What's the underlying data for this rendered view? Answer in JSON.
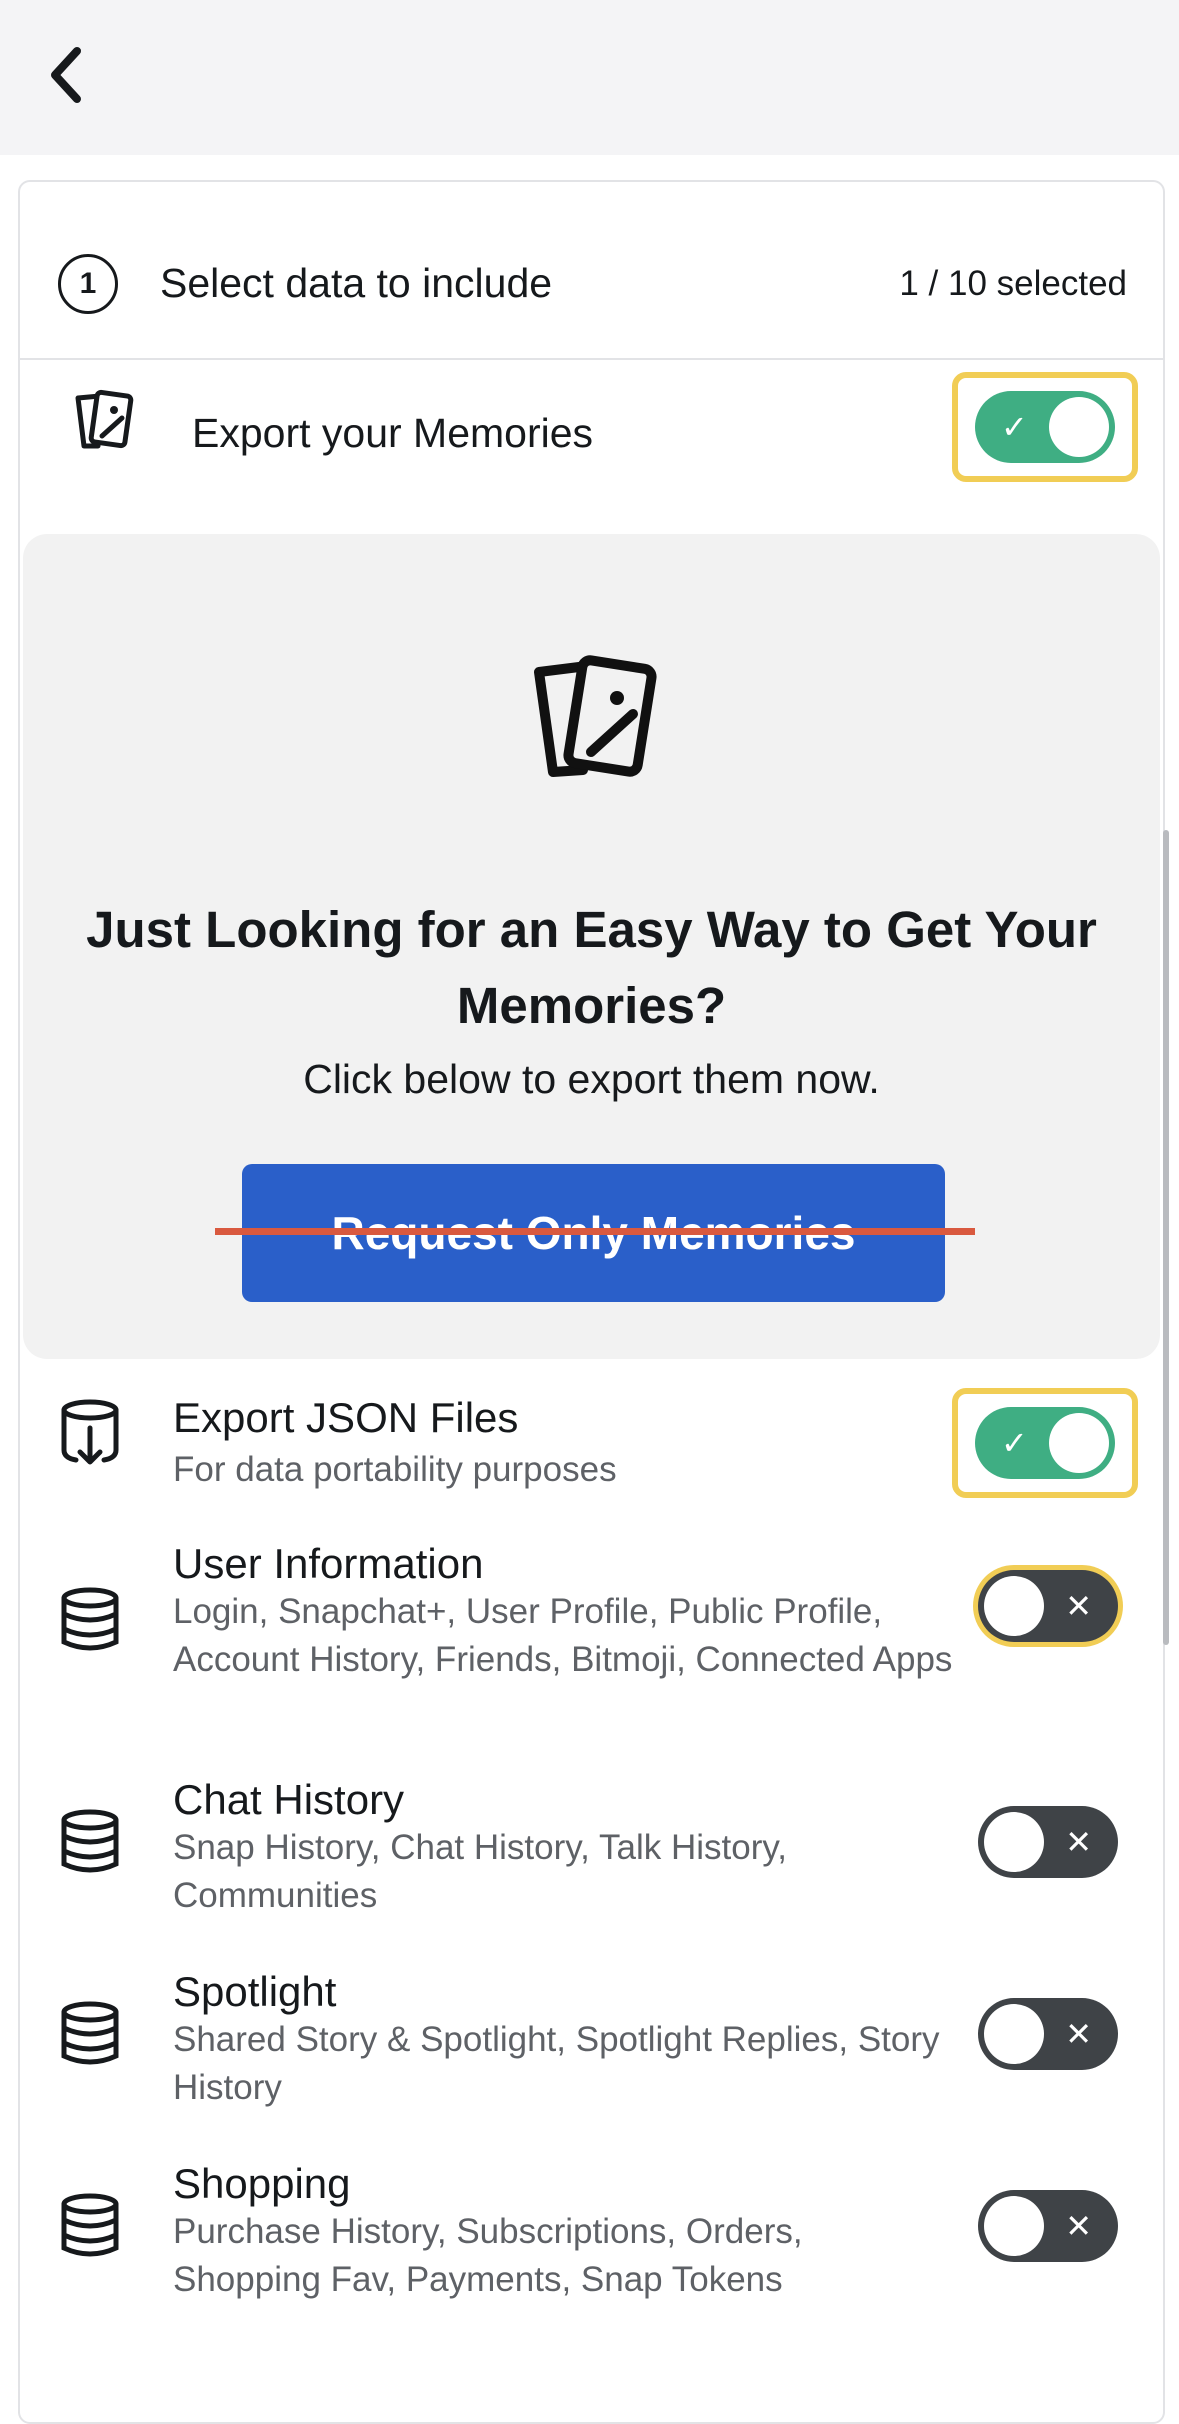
{
  "header": {
    "back_icon": "chevron-left-icon"
  },
  "section": {
    "step_number": "1",
    "title": "Select data to include",
    "selected_count": "1 / 10 selected"
  },
  "memories_toggle": {
    "label": "Export your Memories",
    "icon": "memories-icon",
    "on": true
  },
  "promo": {
    "title": "Just Looking for an Easy Way to Get Your Memories?",
    "subtitle": "Click below to export them now.",
    "button_label": "Request Only Memories"
  },
  "rows": [
    {
      "title": "Export JSON Files",
      "desc": "For data portability purposes",
      "icon": "json-export-icon",
      "on": true
    },
    {
      "title": "User Information",
      "desc": "Login, Snapchat+, User Profile, Public Profile, Account History, Friends, Bitmoji, Connected Apps",
      "icon": "database-icon",
      "on": false
    },
    {
      "title": "Chat History",
      "desc": "Snap History, Chat History, Talk History, Communities",
      "icon": "database-icon",
      "on": false
    },
    {
      "title": "Spotlight",
      "desc": "Shared Story & Spotlight, Spotlight Replies, Story History",
      "icon": "database-icon",
      "on": false
    },
    {
      "title": "Shopping",
      "desc": "Purchase History, Subscriptions, Orders, Shopping Fav, Payments, Snap Tokens",
      "icon": "database-icon",
      "on": false
    }
  ],
  "colors": {
    "toggle_on": "#3fae83",
    "toggle_off": "#3f4347",
    "highlight": "#f1cd55",
    "button": "#2a5fc9",
    "strike": "#d9593f"
  }
}
